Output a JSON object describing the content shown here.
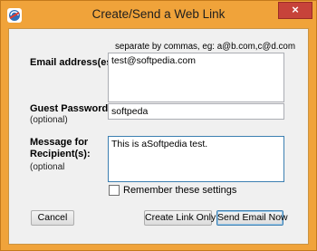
{
  "window": {
    "title": "Create/Send a Web Link",
    "close_glyph": "×",
    "app_icon": "web-link-app-icon",
    "frame_color": "#f0a33a"
  },
  "form": {
    "email": {
      "label": "Email address(es):",
      "hint": "separate by commas, eg: a@b.com,c@d.com",
      "value": "test@softpedia.com"
    },
    "password": {
      "label": "Guest Password:",
      "sublabel": "(optional)",
      "value": "softpeda"
    },
    "message": {
      "label_line1": "Message for",
      "label_line2": "Recipient(s):",
      "sublabel": "(optional",
      "value": "This is aSoftpedia test."
    },
    "remember": {
      "label": "Remember these settings",
      "checked": false
    }
  },
  "buttons": {
    "cancel": "Cancel",
    "create_link": "Create Link Only",
    "send_email": "Send Email Now"
  }
}
